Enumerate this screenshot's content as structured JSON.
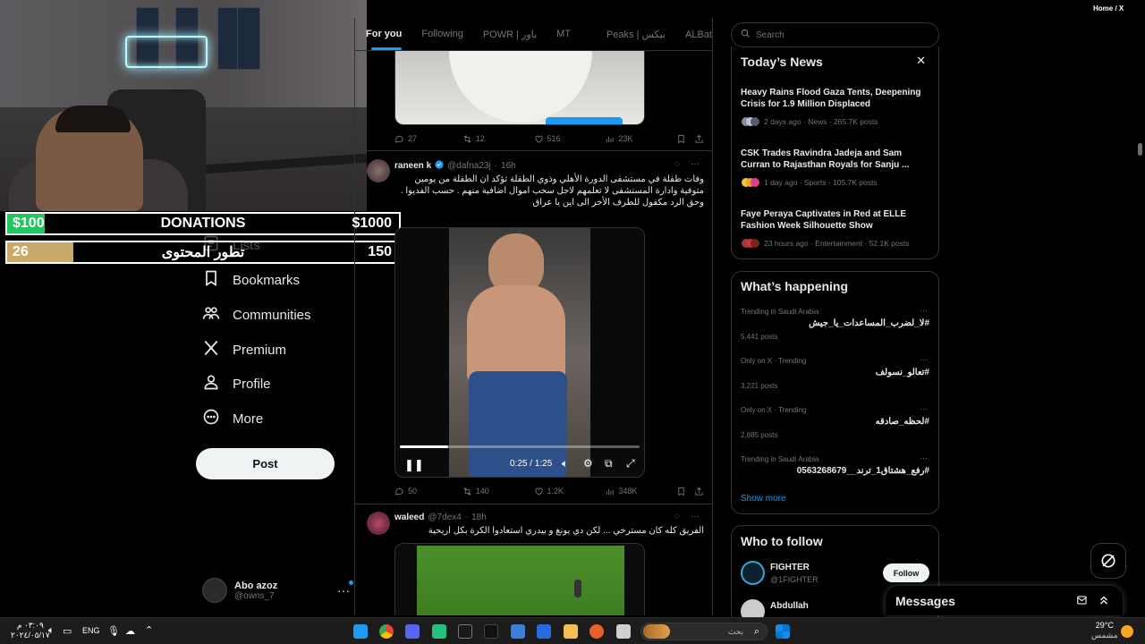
{
  "window": {
    "title": "Home / X"
  },
  "donations": {
    "bar1": {
      "low": "$100",
      "label": "DONATIONS",
      "high": "$1000"
    },
    "bar2": {
      "low": "26",
      "label": "تطور المحتوى",
      "high": "150",
      "progress": 0.17
    }
  },
  "nav": {
    "partial_item": "Lists",
    "items": [
      {
        "label": "Bookmarks",
        "icon": "bookmark-icon"
      },
      {
        "label": "Communities",
        "icon": "communities-icon"
      },
      {
        "label": "Premium",
        "icon": "x-logo-icon"
      },
      {
        "label": "Profile",
        "icon": "person-icon"
      },
      {
        "label": "More",
        "icon": "more-circle-icon"
      }
    ],
    "post_label": "Post",
    "account": {
      "name": "Abo azoz",
      "handle": "@owns_7"
    }
  },
  "tabs": [
    "For you",
    "Following",
    "POWR | باور",
    "MT",
    "Peaks | بيكس",
    "ALBatabet | ب"
  ],
  "timeline": {
    "tweet0": {
      "replies": "27",
      "reposts": "12",
      "likes": "516",
      "views": "23K"
    },
    "tweet1": {
      "name": "raneen k",
      "handle": "@dafna23j",
      "time": "16h",
      "text": "وفات طفلة في مستشفى الدورة الأهلي وذوي الطفلة تؤكد ان الطفلة من يومين متوفية وادارة المستشفى لا تعلمهم لاجل سحب اموال اضافية منهم . حسب الفديوا . وحق الرد مكفول للطرف الأخر الى اين يا عراق",
      "video_time": "0:25 / 1:25",
      "video_progress": 0.2,
      "replies": "50",
      "reposts": "140",
      "likes": "1.2K",
      "views": "348K"
    },
    "tweet2": {
      "name": "waleed",
      "handle": "@7dex4",
      "time": "18h",
      "text": "الفريق كله كان مسترخي ... لكن دي يونغ و بيدري استعادوا الكرة بكل اريحية"
    }
  },
  "search": {
    "placeholder": "Search"
  },
  "news": {
    "title": "Today’s News",
    "items": [
      {
        "title": "Heavy Rains Flood Gaza Tents, Deepening Crisis for 1.9 Million Displaced",
        "meta": "2 days ago · News · 265.7K posts"
      },
      {
        "title": "CSK Trades Ravindra Jadeja and Sam Curran to Rajasthan Royals for Sanju ...",
        "meta": "1 day ago · Sports · 105.7K posts"
      },
      {
        "title": "Faye Peraya Captivates in Red at ELLE Fashion Week Silhouette Show",
        "meta": "23 hours ago · Entertainment · 52.1K posts"
      }
    ]
  },
  "happening": {
    "title": "What’s happening",
    "trends": [
      {
        "context": "Trending in Saudi Arabia",
        "name": "#لا_لضرب_المساعدات_يا_جيش",
        "count": "5,441 posts"
      },
      {
        "context": "Only on X · Trending",
        "name": "#تعالو_نسولف",
        "count": "3,221 posts"
      },
      {
        "context": "Only on X · Trending",
        "name": "#لحظه_صادقه",
        "count": "2,885 posts"
      },
      {
        "context": "Trending in Saudi Arabia",
        "name": "#رفع_هشتاق1_ترند__0563268679",
        "count": ""
      }
    ],
    "show_more": "Show more"
  },
  "who_to_follow": {
    "title": "Who to follow",
    "users": [
      {
        "name": "FIGHTER",
        "handle": "@1FIGHTER",
        "button": "Follow"
      },
      {
        "name": "Abdullah",
        "handle": ""
      }
    ]
  },
  "messages": {
    "title": "Messages"
  },
  "taskbar": {
    "time": "٠٣:٠٩ م",
    "date": "٢٠٢٤/٠٥/١٧",
    "lang": "ENG",
    "search_placeholder": "بحث",
    "weather_temp": "29°C",
    "weather_desc": "مشمس"
  },
  "colors": {
    "accent": "#1d9bf0",
    "bar_fill_1": "#22c55e",
    "bar_fill_2": "#c8a96a"
  }
}
